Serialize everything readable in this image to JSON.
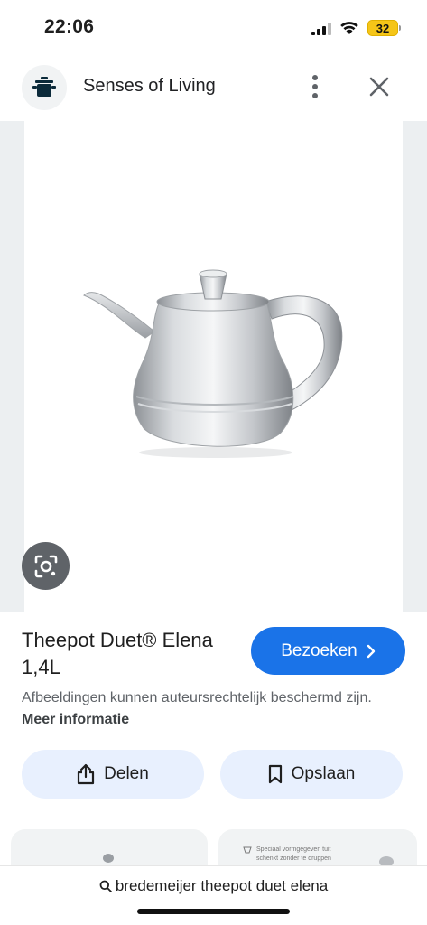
{
  "status_bar": {
    "time": "22:06",
    "battery": "32"
  },
  "header": {
    "site_name": "Senses of Living",
    "site_icon": "pot-icon"
  },
  "product": {
    "title": "Theepot Duet® Elena 1,4L",
    "visit_label": "Bezoeken",
    "disclaimer": "Afbeeldingen kunnen auteursrechtelijk beschermd zijn.",
    "more_info": "Meer informatie"
  },
  "actions": {
    "share_label": "Delen",
    "save_label": "Opslaan"
  },
  "related": {
    "card2_text": "Speciaal vormgegeven tuit\nschenkt zonder te druppen"
  },
  "search": {
    "query": "bredemeijer theepot duet elena"
  },
  "colors": {
    "accent": "#1a73e8",
    "chip_bg": "#e8f0fe",
    "battery": "#f5c518"
  }
}
